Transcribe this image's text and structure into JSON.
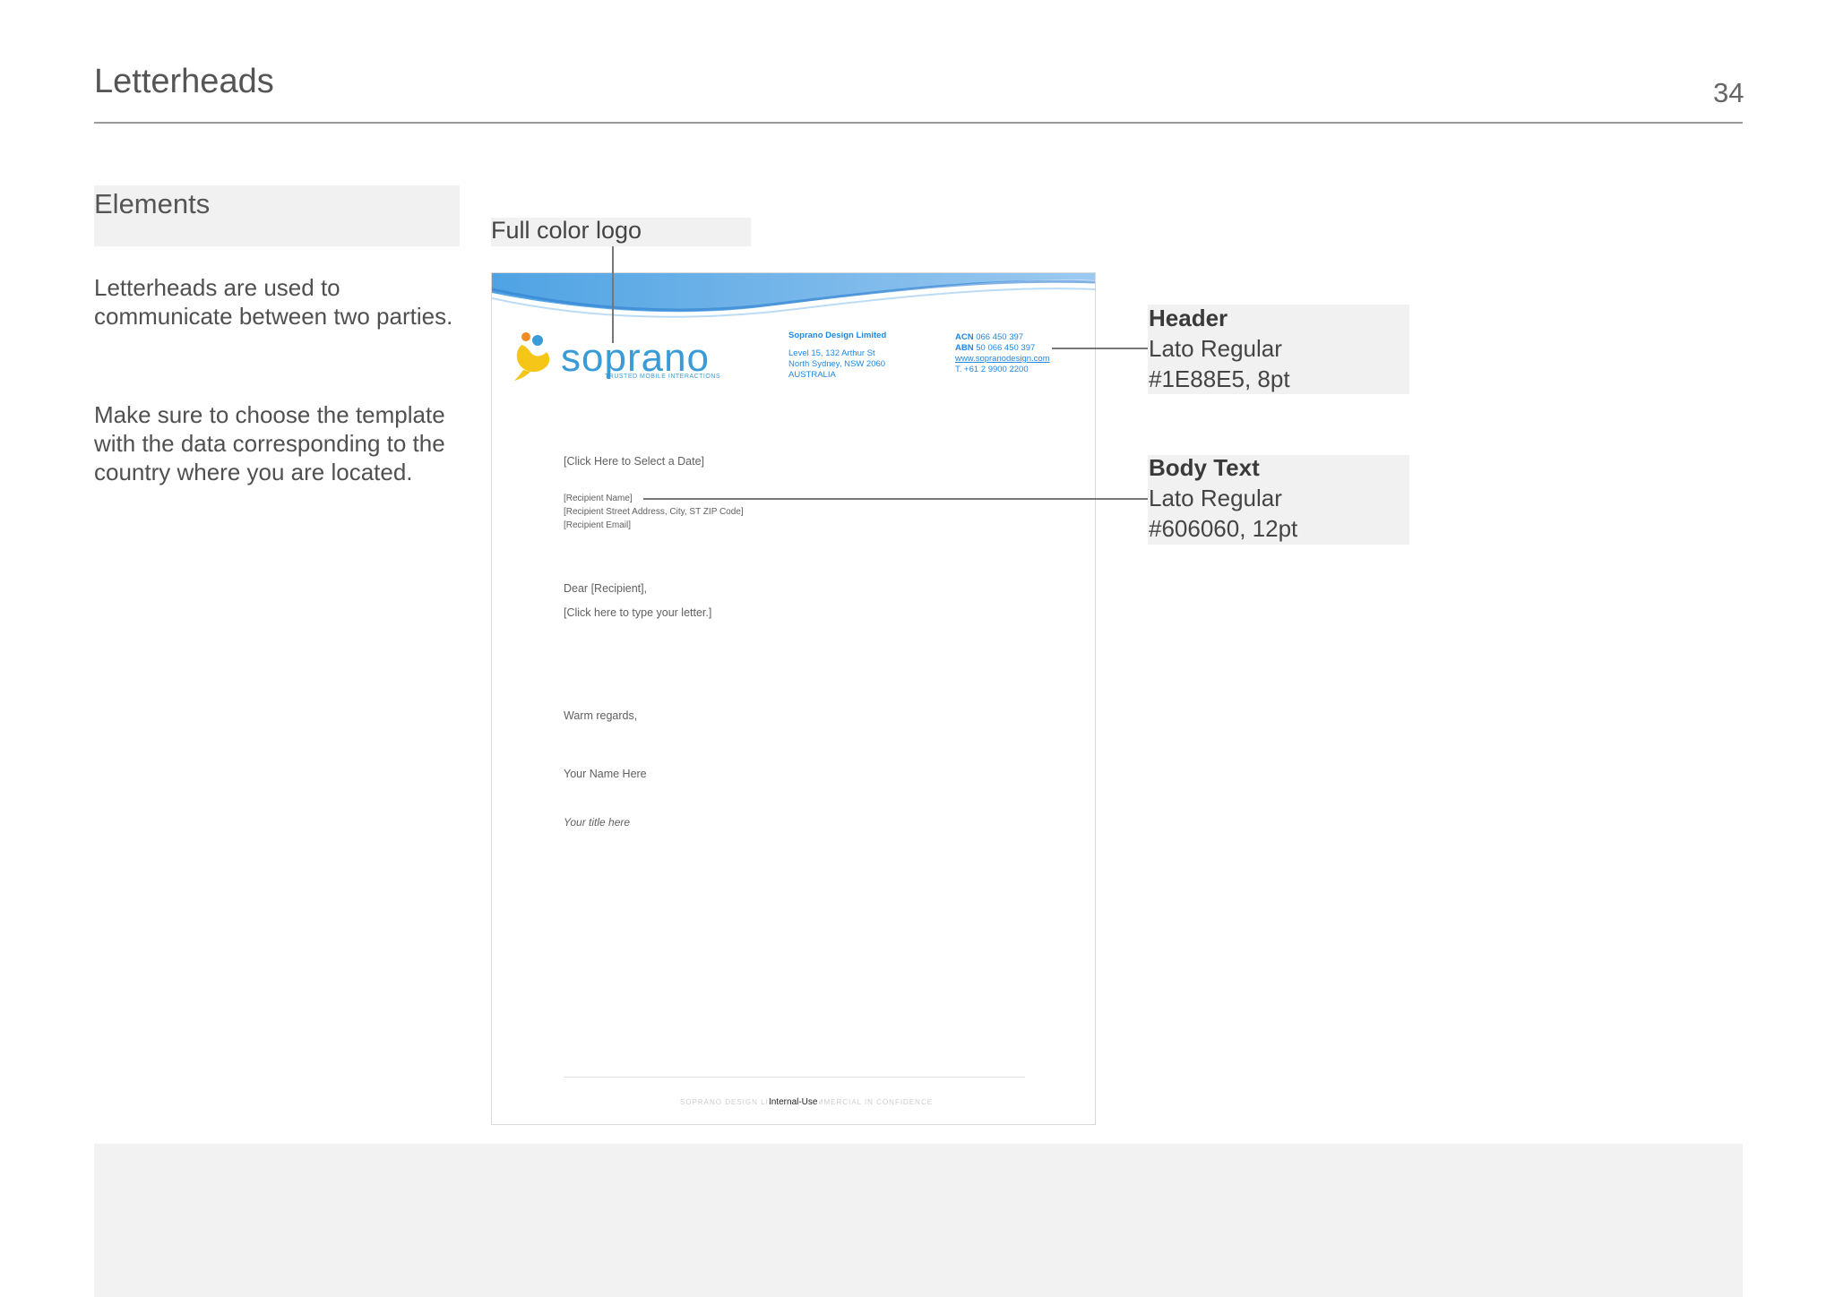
{
  "page": {
    "title": "Letterheads",
    "number": "34"
  },
  "sidebar": {
    "heading": "Elements",
    "paragraphs": [
      "Letterheads are used to communicate between two parties.",
      "Make sure to choose the template with the data corresponding to the country where you are located."
    ]
  },
  "callouts": {
    "logo_label": "Full color logo",
    "header": {
      "title": "Header",
      "font": "Lato Regular",
      "spec": "#1E88E5, 8pt"
    },
    "body_text": {
      "title": "Body Text",
      "font": "Lato Regular",
      "spec": "#606060, 12pt"
    }
  },
  "letter": {
    "logo": {
      "word": "soprano",
      "tagline": "TRUSTED MOBILE INTERACTIONS"
    },
    "company": {
      "name": "Soprano Design Limited",
      "address": [
        "Level 15, 132 Arthur St",
        "North Sydney, NSW 2060",
        "AUSTRALIA"
      ]
    },
    "ids": {
      "acn_label": "ACN",
      "acn": "066 450 397",
      "abn_label": "ABN",
      "abn": "50 066 450 397",
      "website": "www.sopranodesign.com",
      "phone": "T. +61 2 9900 2200"
    },
    "date_placeholder": "[Click Here to Select a Date]",
    "recipient": [
      "[Recipient Name]",
      "[Recipient Street Address, City, ST ZIP Code]",
      "[Recipient Email]"
    ],
    "salutation": "Dear [Recipient],",
    "body_placeholder": "[Click here to type your letter.]",
    "closing": "Warm regards,",
    "signature_name": "Your Name Here",
    "signature_title": "Your title here",
    "footer_faint": "SOPRANO DESIGN LIMITED · COMMERCIAL IN CONFIDENCE",
    "footer_label": "Internal-Use"
  },
  "colors": {
    "header_blue": "#1E88E5",
    "body_gray": "#606060",
    "logo_yellow": "#F5C518",
    "logo_orange": "#F08A24",
    "logo_blue": "#3A9BD6"
  }
}
